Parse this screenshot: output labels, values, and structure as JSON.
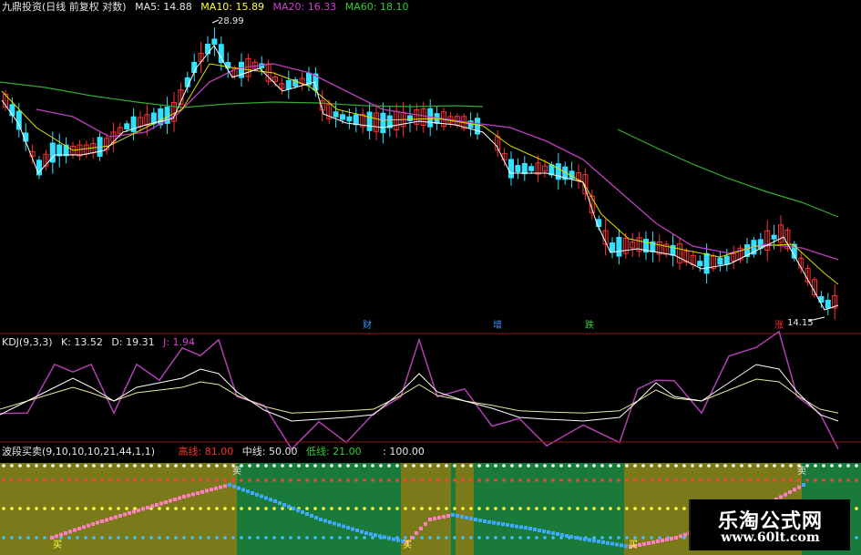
{
  "header": {
    "title": "九鼎投资(日线 前复权 对数)",
    "ma5": "MA5: 14.88",
    "ma10": "MA10: 15.89",
    "ma20": "MA20: 16.33",
    "ma60": "MA60: 18.10"
  },
  "price_panel": {
    "high_label": "28.99",
    "low_label": "14.15",
    "event_marks": [
      "财",
      "增",
      "跌",
      "涨"
    ]
  },
  "kdj_header": {
    "name": "KDJ(9,3,3)",
    "k": "K: 13.52",
    "d": "D: 19.31",
    "j": "J: 1.94"
  },
  "wave_header": {
    "name": "波段买卖(9,10,10,10,21,44,1,1)",
    "high": "高线: 81.00",
    "mid": "中线: 50.00",
    "low": "低线: 21.00",
    "extra": ": 100.00"
  },
  "signals": {
    "buy": "买",
    "sell": "卖"
  },
  "watermark": {
    "brand": "乐淘公式网",
    "url": "www.60lt.com"
  },
  "colors": {
    "up": "#ff3030",
    "down": "#33e0ff",
    "ma5": "#ffffff",
    "ma10": "#e0e000",
    "ma20": "#c040c0",
    "ma60": "#33aa33",
    "panel_line": "#8b1a1a",
    "band_green": "#1a7a3a",
    "band_olive": "#7a7a1a"
  },
  "chart_data": {
    "type": "candlestick",
    "price_high": 28.99,
    "price_low": 14.15,
    "ma_latest": {
      "MA5": 14.88,
      "MA10": 15.89,
      "MA20": 16.33,
      "MA60": 18.1
    },
    "kdj_latest": {
      "K": 13.52,
      "D": 19.31,
      "J": 1.94
    },
    "wave_levels": {
      "high": 81.0,
      "mid": 50.0,
      "low": 21.0,
      "top": 100.0
    }
  }
}
